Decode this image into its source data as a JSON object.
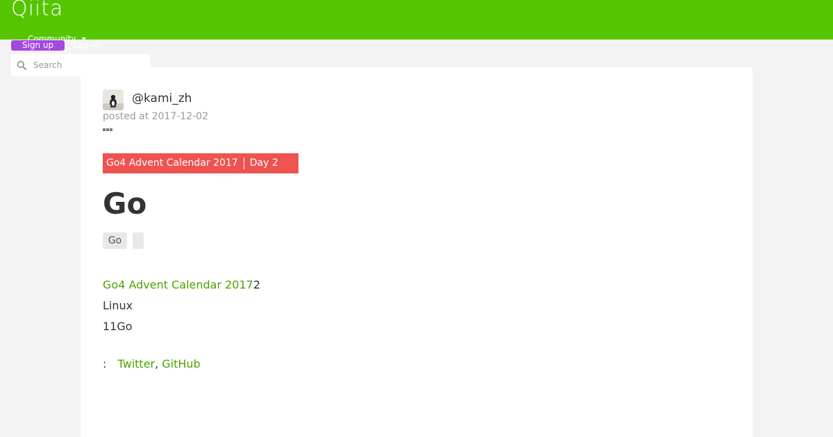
{
  "header": {
    "logo": "Qiita",
    "community_label": "Community",
    "community_caret": "▼",
    "signup_label": "Sign up",
    "login_label": "Log in",
    "search_placeholder": "Search"
  },
  "article": {
    "author": "@kami_zh",
    "posted_at": "posted at 2017-12-02",
    "calendar": {
      "name": "Go4 Advent Calendar 2017",
      "day": "Day 2"
    },
    "title": "Go",
    "tags": [
      "Go",
      ""
    ],
    "body": {
      "line1_link": "Go4 Advent Calendar 2017",
      "line1_rest": "2",
      "line2": "Linux",
      "line3": "11Go",
      "line4_prefix": ":",
      "twitter_link": "Twitter",
      "separator": ", ",
      "github_link": "GitHub"
    }
  },
  "colors": {
    "header_bg": "#55c500",
    "signup_bg": "#a448e0",
    "calendar_bg": "#ef5350",
    "link": "#4aa300"
  },
  "icons": [
    "search-icon",
    "avatar",
    "more-icon"
  ]
}
